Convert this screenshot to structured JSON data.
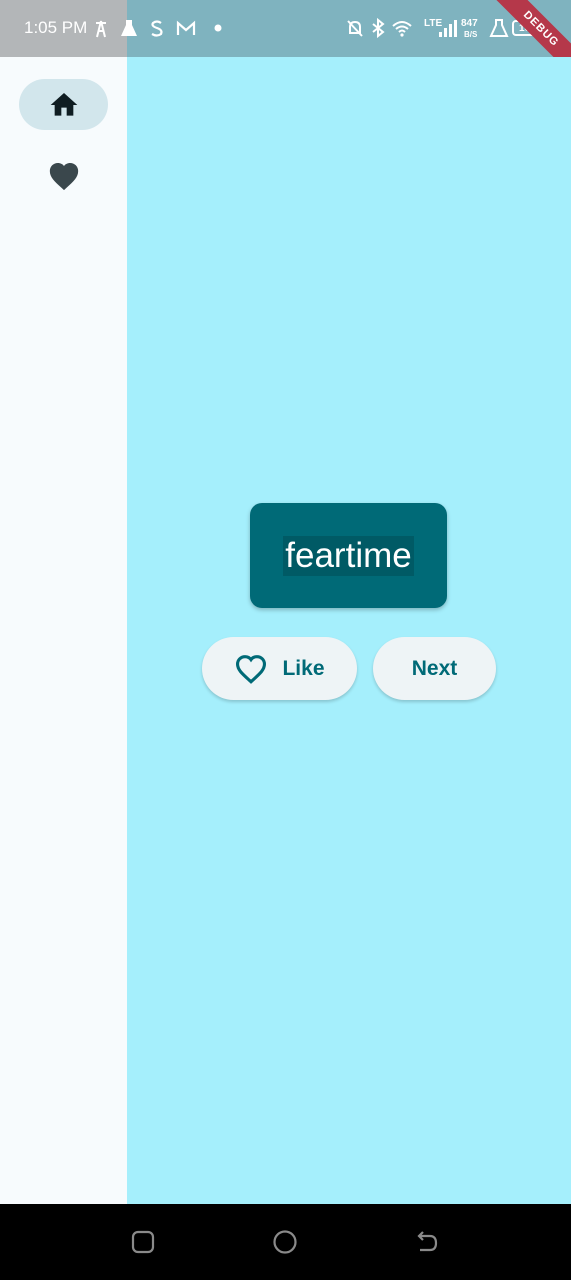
{
  "status_bar": {
    "time": "1:05 PM",
    "speed_value": "847",
    "speed_unit": "B/S",
    "network": "LTE",
    "battery": "100",
    "debug_label": "DEBUG"
  },
  "nav_rail": {
    "items": [
      {
        "name": "home",
        "icon": "home-icon",
        "selected": true
      },
      {
        "name": "favorites",
        "icon": "heart-icon",
        "selected": false
      }
    ]
  },
  "main": {
    "word": "feartime",
    "like_label": "Like",
    "next_label": "Next"
  },
  "colors": {
    "background": "#a5effc",
    "card": "#006a77",
    "accent": "#006a77",
    "rail": "#f7fbfd",
    "rail_selected": "#d2e6ec"
  }
}
